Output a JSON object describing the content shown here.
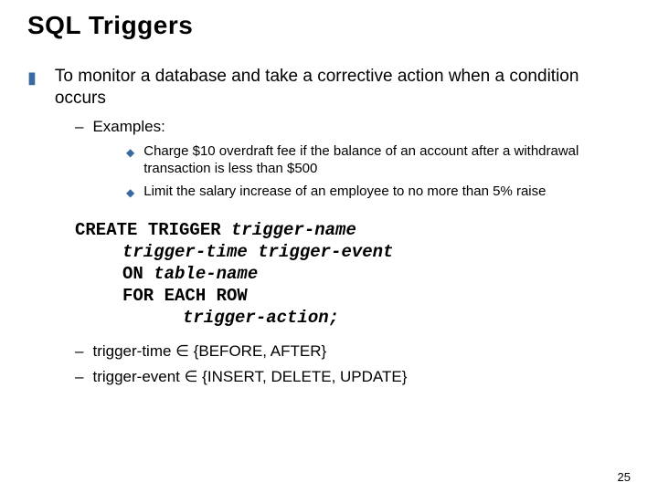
{
  "title": "SQL Triggers",
  "main_point": "To monitor a database and take a corrective action when a condition occurs",
  "examples_label": "Examples:",
  "examples": [
    "Charge $10 overdraft fee if the balance of an account after a withdrawal transaction is less than $500",
    "Limit the salary increase of an employee to no more than 5% raise"
  ],
  "code": {
    "l1a": "CREATE TRIGGER ",
    "l1b": "trigger-name",
    "l2": "trigger-time trigger-event",
    "l3a": "ON ",
    "l3b": "table-name",
    "l4": "FOR EACH ROW",
    "l5": "trigger-action;"
  },
  "sets": [
    {
      "label": "trigger-time",
      "values": "{BEFORE, AFTER}"
    },
    {
      "label": "trigger-event",
      "values": "{INSERT, DELETE, UPDATE}"
    }
  ],
  "page_number": "25"
}
